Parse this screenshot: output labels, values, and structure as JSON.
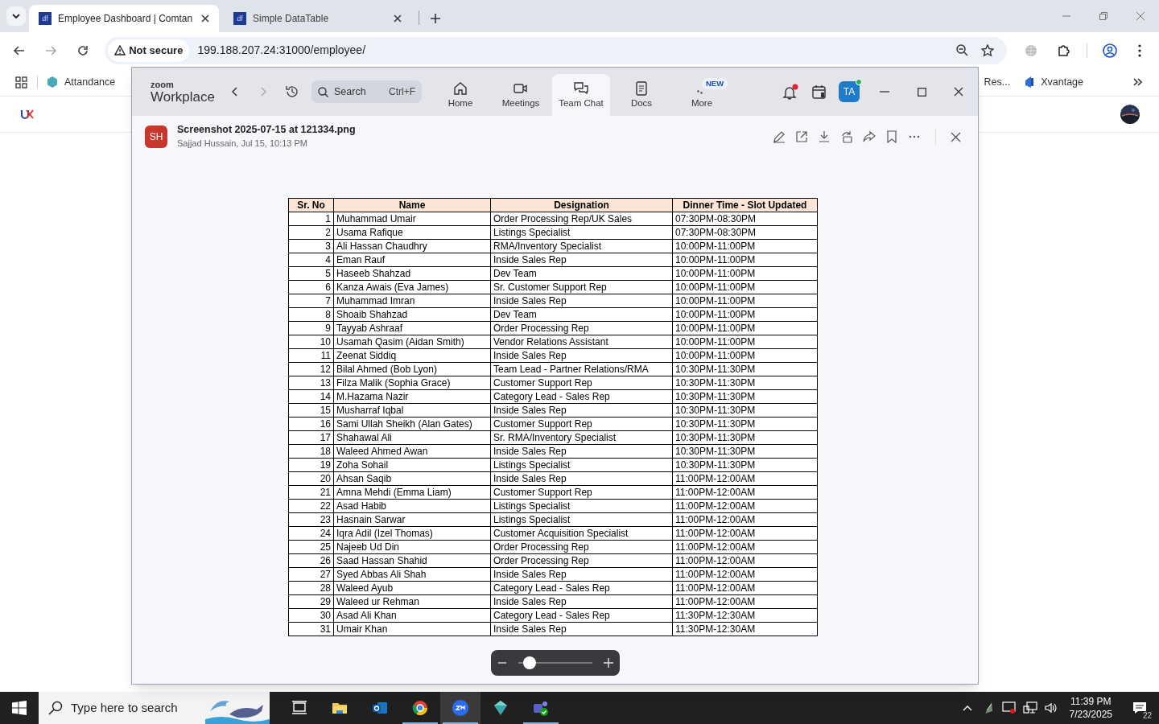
{
  "browser": {
    "tabs": [
      {
        "favicon_text": "df",
        "title": "Employee Dashboard | Comtan",
        "selected": true
      },
      {
        "favicon_text": "df",
        "title": "Simple DataTable",
        "selected": false
      }
    ],
    "address": {
      "security": "Not secure",
      "url": "199.188.207.24:31000/employee/"
    },
    "bookmarks_left": [
      "Attandance"
    ],
    "bookmarks_right": [
      "Res...",
      "Xvantage"
    ]
  },
  "zoom_window": {
    "logo_small": "zoom",
    "logo_big": "Workplace",
    "search": {
      "placeholder": "Search",
      "shortcut": "Ctrl+F"
    },
    "nav": [
      {
        "label": "Home",
        "selected": false
      },
      {
        "label": "Meetings",
        "selected": false
      },
      {
        "label": "Team Chat",
        "selected": true
      },
      {
        "label": "Docs",
        "selected": false
      },
      {
        "label": "More",
        "selected": false,
        "badge": "NEW"
      }
    ],
    "avatar": "TA",
    "file": {
      "avatar": "SH",
      "name": "Screenshot 2025-07-15 at 121334.png",
      "meta": "Sajjad Hussain, Jul 15, 10:13 PM"
    },
    "table": {
      "columns": [
        "Sr. No",
        "Name",
        "Designation",
        "Dinner Time - Slot Updated"
      ],
      "rows": [
        [
          "1",
          "Muhammad Umair",
          "Order Processing Rep/UK Sales",
          "07:30PM-08:30PM"
        ],
        [
          "2",
          "Usama Rafique",
          "Listings Specialist",
          "07:30PM-08:30PM"
        ],
        [
          "3",
          "Ali Hassan Chaudhry",
          "RMA/Inventory Specialist",
          "10:00PM-11:00PM"
        ],
        [
          "4",
          "Eman Rauf",
          "Inside Sales Rep",
          "10:00PM-11:00PM"
        ],
        [
          "5",
          "Haseeb Shahzad",
          "Dev Team",
          "10:00PM-11:00PM"
        ],
        [
          "6",
          "Kanza Awais (Eva James)",
          "Sr. Customer Support Rep",
          "10:00PM-11:00PM"
        ],
        [
          "7",
          "Muhammad Imran",
          "Inside Sales Rep",
          "10:00PM-11:00PM"
        ],
        [
          "8",
          "Shoaib Shahzad",
          "Dev Team",
          "10:00PM-11:00PM"
        ],
        [
          "9",
          "Tayyab Ashraaf",
          "Order Processing Rep",
          "10:00PM-11:00PM"
        ],
        [
          "10",
          "Usamah Qasim (Aidan Smith)",
          "Vendor Relations Assistant",
          "10:00PM-11:00PM"
        ],
        [
          "11",
          "Zeenat Siddiq",
          "Inside Sales Rep",
          "10:00PM-11:00PM"
        ],
        [
          "12",
          "Bilal Ahmed (Bob Lyon)",
          "Team Lead - Partner Relations/RMA",
          "10:30PM-11:30PM"
        ],
        [
          "13",
          "Filza Malik (Sophia Grace)",
          "Customer Support Rep",
          "10:30PM-11:30PM"
        ],
        [
          "14",
          "M.Hazama Nazir",
          "Category Lead - Sales Rep",
          "10:30PM-11:30PM"
        ],
        [
          "15",
          "Musharraf Iqbal",
          "Inside Sales Rep",
          "10:30PM-11:30PM"
        ],
        [
          "16",
          "Sami Ullah Sheikh (Alan Gates)",
          "Customer Support Rep",
          "10:30PM-11:30PM"
        ],
        [
          "17",
          "Shahawal Ali",
          "Sr. RMA/Inventory Specialist",
          "10:30PM-11:30PM"
        ],
        [
          "18",
          "Waleed Ahmed Awan",
          "Inside Sales Rep",
          "10:30PM-11:30PM"
        ],
        [
          "19",
          "Zoha Sohail",
          "Listings Specialist",
          "10:30PM-11:30PM"
        ],
        [
          "20",
          "Ahsan Saqib",
          "Inside Sales Rep",
          "11:00PM-12:00AM"
        ],
        [
          "21",
          "Amna Mehdi (Emma Liam)",
          "Customer Support Rep",
          "11:00PM-12:00AM"
        ],
        [
          "22",
          "Asad Habib",
          "Listings Specialist",
          "11:00PM-12:00AM"
        ],
        [
          "23",
          "Hasnain Sarwar",
          "Listings Specialist",
          "11:00PM-12:00AM"
        ],
        [
          "24",
          "Iqra Adil (Izel Thomas)",
          "Customer Acquisition Specialist",
          "11:00PM-12:00AM"
        ],
        [
          "25",
          "Najeeb Ud Din",
          "Order Processing Rep",
          "11:00PM-12:00AM"
        ],
        [
          "26",
          "Saad Hassan Shahid",
          "Order Processing Rep",
          "11:00PM-12:00AM"
        ],
        [
          "27",
          "Syed Abbas Ali Shah",
          "Inside Sales Rep",
          "11:00PM-12:00AM"
        ],
        [
          "28",
          "Waleed Ayub",
          "Category Lead - Sales Rep",
          "11:00PM-12:00AM"
        ],
        [
          "29",
          "Waleed ur Rehman",
          "Inside Sales Rep",
          "11:00PM-12:00AM"
        ],
        [
          "30",
          "Asad Ali Khan",
          "Category Lead - Sales Rep",
          "11:30PM-12:30AM"
        ],
        [
          "31",
          "Umair Khan",
          "Inside Sales Rep",
          "11:30PM-12:30AM"
        ]
      ]
    },
    "zoom_slider": {
      "level": 0.08
    }
  },
  "taskbar": {
    "search_placeholder": "Type here to search",
    "apps": [
      {
        "running": false,
        "selected": false
      },
      {
        "running": false,
        "selected": false
      },
      {
        "running": false,
        "selected": false
      },
      {
        "running": true,
        "selected": false
      },
      {
        "running": true,
        "selected": true
      },
      {
        "running": false,
        "selected": false
      },
      {
        "running": true,
        "selected": false
      }
    ],
    "time": "11:39 PM",
    "date": "7/23/2025",
    "notification_count": "22"
  }
}
